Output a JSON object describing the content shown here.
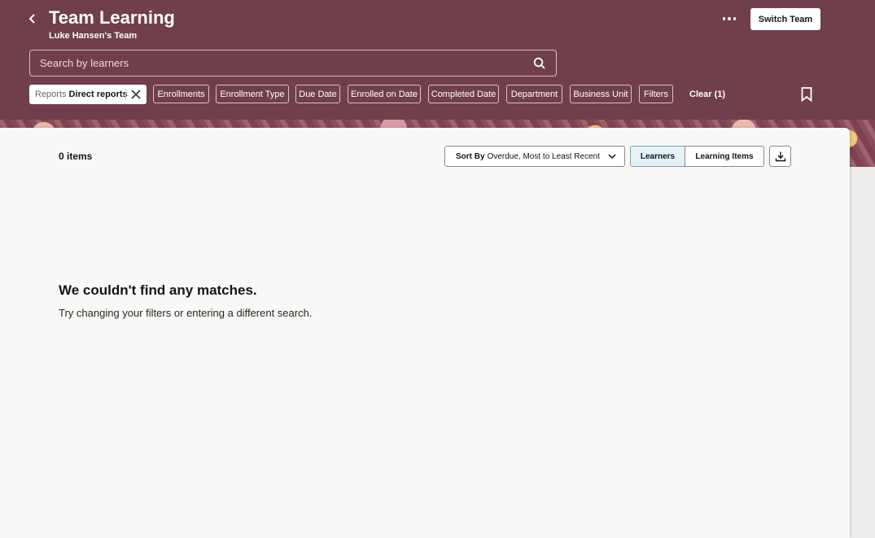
{
  "header": {
    "title": "Team Learning",
    "subtitle": "Luke Hansen's Team",
    "switch_team_label": "Switch Team",
    "bg_color": "#703f4b"
  },
  "search": {
    "placeholder": "Search by learners"
  },
  "filters": {
    "active": {
      "label": "Reports",
      "value": "Direct reports"
    },
    "chips": [
      "Enrollments",
      "Enrollment Type",
      "Due Date",
      "Enrolled on Date",
      "Completed Date",
      "Department",
      "Business Unit",
      "Filters"
    ],
    "clear_label": "Clear (1)"
  },
  "results": {
    "count_label": "0 items",
    "sort_label": "Sort By",
    "sort_value": "Overdue, Most to Least Recent",
    "view_toggle": [
      "Learners",
      "Learning Items"
    ],
    "selected_view": "Learners"
  },
  "empty_state": {
    "title": "We couldn't find any matches.",
    "message": "Try changing your filters or entering a different search."
  },
  "icons": [
    "chevron-left-icon",
    "more-icon",
    "search-icon",
    "close-icon",
    "bookmark-icon",
    "chevron-down-icon",
    "download-icon"
  ]
}
